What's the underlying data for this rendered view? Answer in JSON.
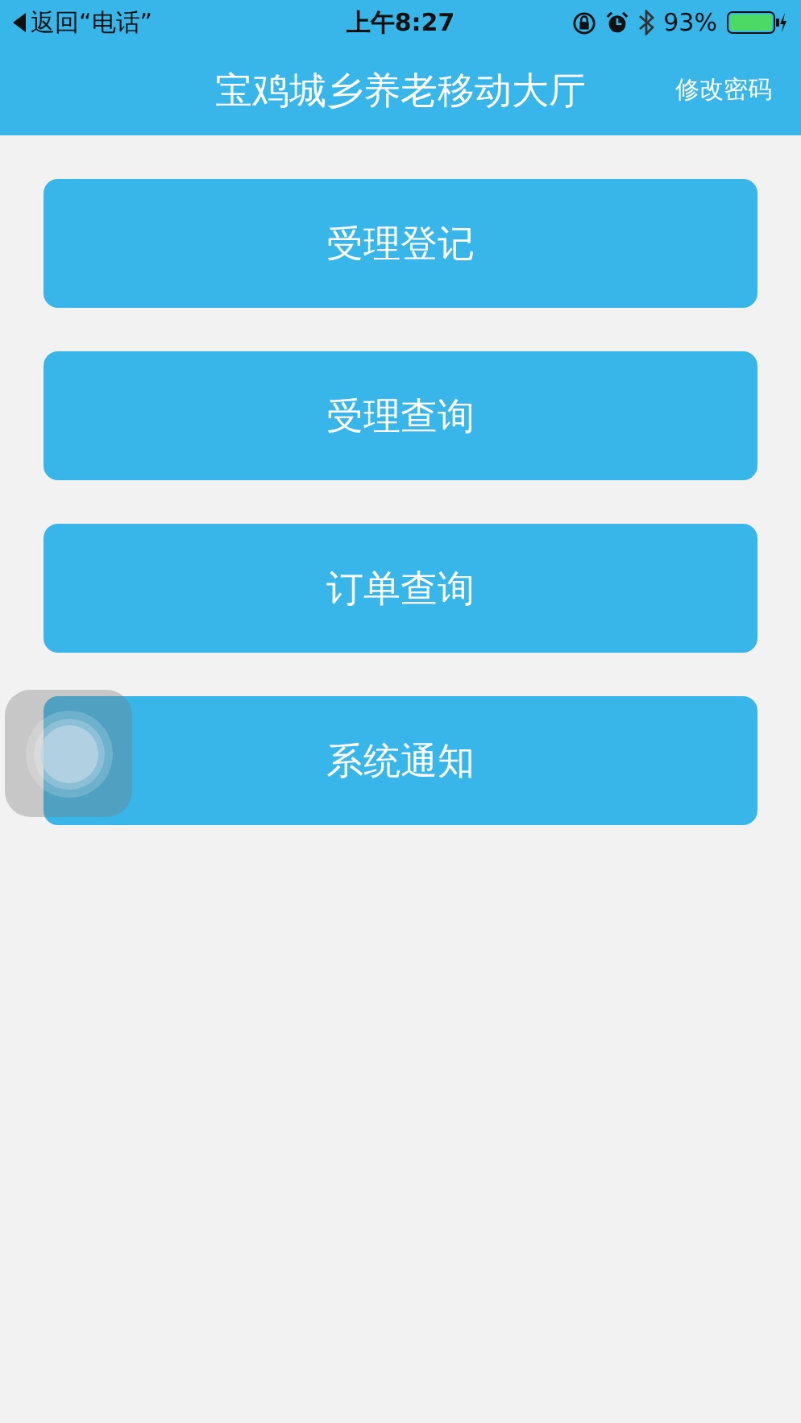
{
  "status_bar": {
    "back": "返回“电话”",
    "time": "上午8:27",
    "battery": "93%"
  },
  "header": {
    "title": "宝鸡城乡养老移动大厅",
    "action": "修改密码"
  },
  "menu": [
    {
      "label": "受理登记"
    },
    {
      "label": "受理查询"
    },
    {
      "label": "订单查询"
    },
    {
      "label": "系统通知"
    }
  ]
}
